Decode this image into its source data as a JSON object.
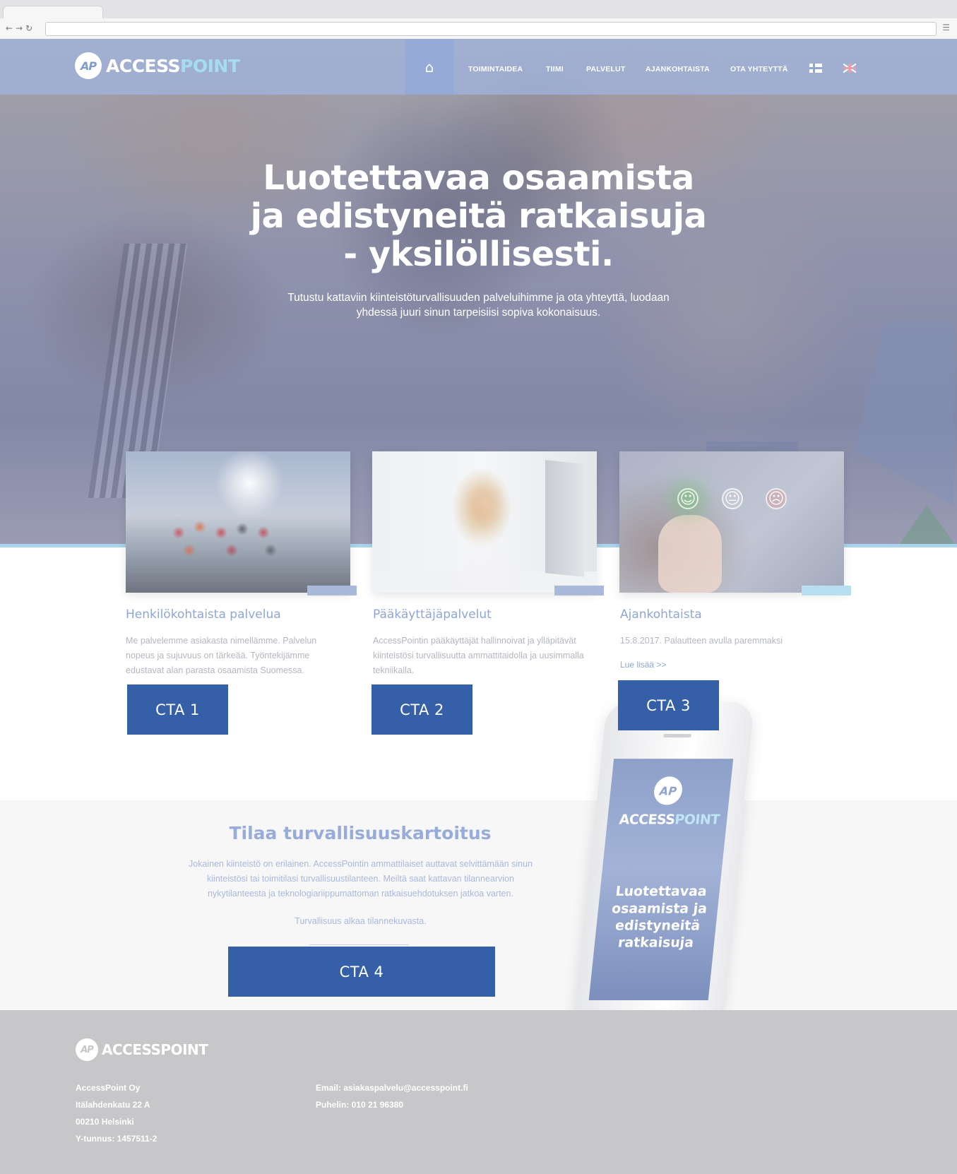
{
  "nav": {
    "items": [
      "TOIMINTAIDEA",
      "TIIMI",
      "PALVELUT",
      "AJANKOHTAISTA",
      "OTA YHTEYTTÄ"
    ],
    "home_icon": "home-icon",
    "languages": [
      "fi-flag-icon",
      "uk-flag-icon"
    ]
  },
  "brand": {
    "badge": "AP",
    "name_part1": "ACCESS",
    "name_part2": "POINT",
    "accent_color": "#a5dcf0"
  },
  "hero": {
    "title": "Luotettavaa osaamista\nja edistyneitä ratkaisuja\n- yksilöllisesti.",
    "subtitle": "Tutustu kattaviin kiinteistöturvallisuuden palveluihimme ja ota yhteyttä, luodaan\nyhdessä juuri sinun tarpeisiisi sopiva kokonaisuus."
  },
  "cards": [
    {
      "title": "Henkilökohtaista palvelua",
      "body": "Me palvelemme asiakasta nimellämme. Palvelun nopeus ja sujuvuus on tärkeää. Työntekijämme edustavat alan parasta osaamista Suomessa.",
      "cta": "CTA 1"
    },
    {
      "title": "Pääkäyttäjäpalvelut",
      "body": "AccessPointin pääkäyttäjät hallinnoivat ja ylläpitävät kiinteistösi turvallisuutta ammattitaidolla ja uusimmalla tekniikalla.",
      "cta": "CTA 2"
    },
    {
      "title": "Ajankohtaista",
      "body": "15.8.2017. Palautteen avulla paremmaksi",
      "link": "Lue lisää >>",
      "cta": "CTA 3"
    }
  ],
  "feedback_icons": {
    "happy": "☺",
    "neutral": "😐",
    "sad": "☹"
  },
  "security": {
    "title": "Tilaa turvallisuuskartoitus",
    "body": "Jokainen kiinteistö on erilainen. AccessPointin ammattilaiset auttavat selvittämään sinun\nkiinteistösi tai toimitilasi turvallisuustilanteen. Meiltä saat kattavan tilannearvion\nnykytilanteesta ja teknologiariippumattoman ratkaisuehdotuksen jatkoa varten.",
    "tagline": "Turvallisuus alkaa tilannekuvasta.",
    "cta": "CTA 4"
  },
  "phone": {
    "badge": "AP",
    "brand_a": "ACCESS",
    "brand_b": "POINT",
    "text": "Luotettavaa\nosaamista ja\nedistyneitä\nratkaisuja"
  },
  "footer": {
    "company": "AccessPoint Oy",
    "street": "Itälahdenkatu 22 A",
    "city": "00210 Helsinki",
    "business_id": "Y-tunnus: 1457511-2",
    "email": "Email: asiakaspalvelu@accesspoint.fi",
    "phone": "Puhelin: 010 21 96380"
  },
  "colors": {
    "cta": "#3560a8",
    "nav_overlay": "#a0b4e1",
    "footer": "#c7c7c9",
    "title_blue": "#8ea6d7"
  }
}
